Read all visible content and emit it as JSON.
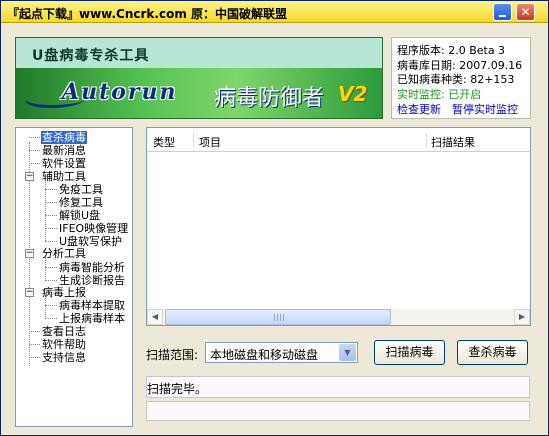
{
  "window": {
    "title": "『起点下载』www.Cncrk.com 原：中国破解联盟"
  },
  "banner": {
    "app_name": "U盘病毒专杀工具",
    "logo_text": "Autorun",
    "subtitle": "病毒防御者",
    "version_badge": "V2"
  },
  "info": {
    "program_version": "程序版本: 2.0 Beta 3",
    "db_date": "病毒库日期: 2007.09.16",
    "known_viruses": "已知病毒种类: 82+153",
    "realtime_status": "实时监控: 已开启",
    "check_update": "检查更新",
    "pause_monitor": "暂停实时监控"
  },
  "tree": {
    "items": [
      {
        "label": "查杀病毒",
        "selected": true
      },
      {
        "label": "最新消息"
      },
      {
        "label": "软件设置"
      },
      {
        "label": "辅助工具",
        "expanded": true
      },
      {
        "label": "免疫工具"
      },
      {
        "label": "修复工具"
      },
      {
        "label": "解锁U盘"
      },
      {
        "label": "IFEO映像管理"
      },
      {
        "label": "U盘软写保护"
      },
      {
        "label": "分析工具",
        "expanded": true
      },
      {
        "label": "病毒智能分析"
      },
      {
        "label": "生成诊断报告"
      },
      {
        "label": "病毒上报",
        "expanded": true
      },
      {
        "label": "病毒样本提取"
      },
      {
        "label": "上报病毒样本"
      },
      {
        "label": "查看日志"
      },
      {
        "label": "软件帮助"
      },
      {
        "label": "支持信息"
      }
    ],
    "expander_symbol": "−"
  },
  "list": {
    "columns": [
      "类型",
      "项目",
      "扫描结果"
    ]
  },
  "scan": {
    "range_label": "扫描范围:",
    "range_value": "本地磁盘和移动磁盘",
    "scan_button": "扫描病毒",
    "kill_button": "查杀病毒"
  },
  "status": {
    "message": "扫描完毕。"
  },
  "colors": {
    "title_bar": "#f5d82d",
    "banner_green": "#3c9d3c",
    "selection": "#316ac5",
    "link": "#0000cc",
    "monitor_on": "#1a9a1a"
  }
}
